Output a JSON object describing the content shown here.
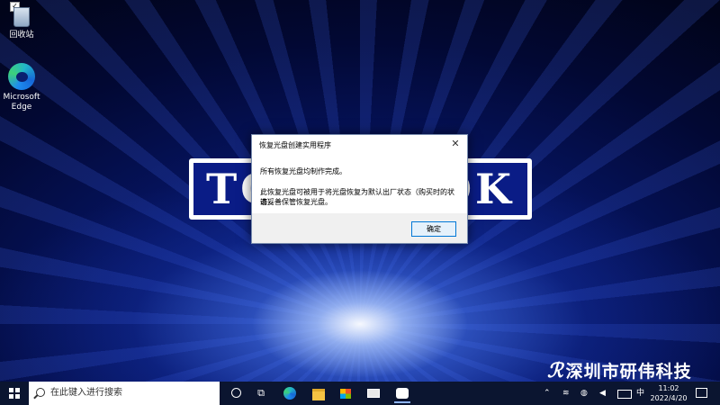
{
  "desktop": {
    "icons": [
      {
        "label": "回收站",
        "icon": "recycle-bin-icon"
      },
      {
        "label": "Microsoft Edge",
        "icon": "edge-icon"
      }
    ],
    "banner": {
      "left": "TO",
      "right": "OK"
    },
    "watermark": "深圳市研伟科技"
  },
  "dialog": {
    "title": "恢复光盘创建实用程序",
    "close_glyph": "✕",
    "message_line1": "所有恢复光盘均制作完成。",
    "message_line2": "此恢复光盘可被用于将光盘恢复为默认出厂状态（购买时的状态）。",
    "message_line3": "请妥善保管恢复光盘。",
    "ok_label": "确定"
  },
  "taskbar": {
    "search_placeholder": "在此键入进行搜索",
    "apps": [
      "edge-icon",
      "file-explorer-icon",
      "store-icon",
      "mail-icon",
      "photos-icon"
    ],
    "tray": {
      "ime": "中",
      "time": "11:02",
      "date": "2022/4/20"
    }
  }
}
